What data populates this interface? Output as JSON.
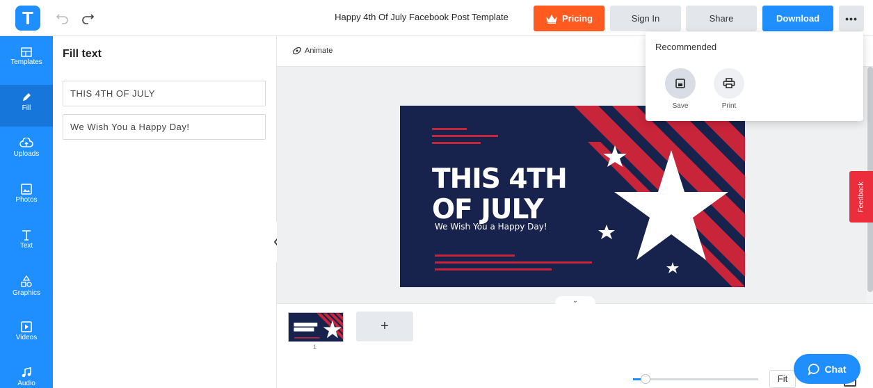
{
  "header": {
    "title": "Happy 4th Of July Facebook Post Template",
    "pricing_label": "Pricing",
    "signin_label": "Sign In",
    "share_label": "Share",
    "download_label": "Download",
    "more_label": "•••",
    "logo_letter": "T"
  },
  "sidebar": {
    "items": [
      {
        "label": "Templates",
        "icon": "templates-icon"
      },
      {
        "label": "Fill",
        "icon": "pencil-icon"
      },
      {
        "label": "Uploads",
        "icon": "cloud-upload-icon"
      },
      {
        "label": "Photos",
        "icon": "image-icon"
      },
      {
        "label": "Text",
        "icon": "text-icon"
      },
      {
        "label": "Graphics",
        "icon": "shapes-icon"
      },
      {
        "label": "Videos",
        "icon": "video-icon"
      },
      {
        "label": "Audio",
        "icon": "music-icon"
      }
    ]
  },
  "panel": {
    "title": "Fill text",
    "fields": [
      "THIS 4TH OF JULY",
      "We Wish You a Happy Day!"
    ]
  },
  "canvas": {
    "animate_label": "Animate",
    "headline_line1": "THIS 4TH",
    "headline_line2": "OF JULY",
    "subtitle": "We Wish You a Happy Day!",
    "feedback_label": "Feedback",
    "colors": {
      "navy": "#18234d",
      "red": "#c8243a",
      "white": "#ffffff"
    }
  },
  "pages": {
    "page_number": "1",
    "add_label": "+",
    "toggle_label": "⌄"
  },
  "zoom": {
    "fit_label": "Fit",
    "level": 0.1
  },
  "chat": {
    "label": "Chat"
  },
  "dropdown": {
    "title": "Recommended",
    "save_label": "Save",
    "print_label": "Print"
  }
}
